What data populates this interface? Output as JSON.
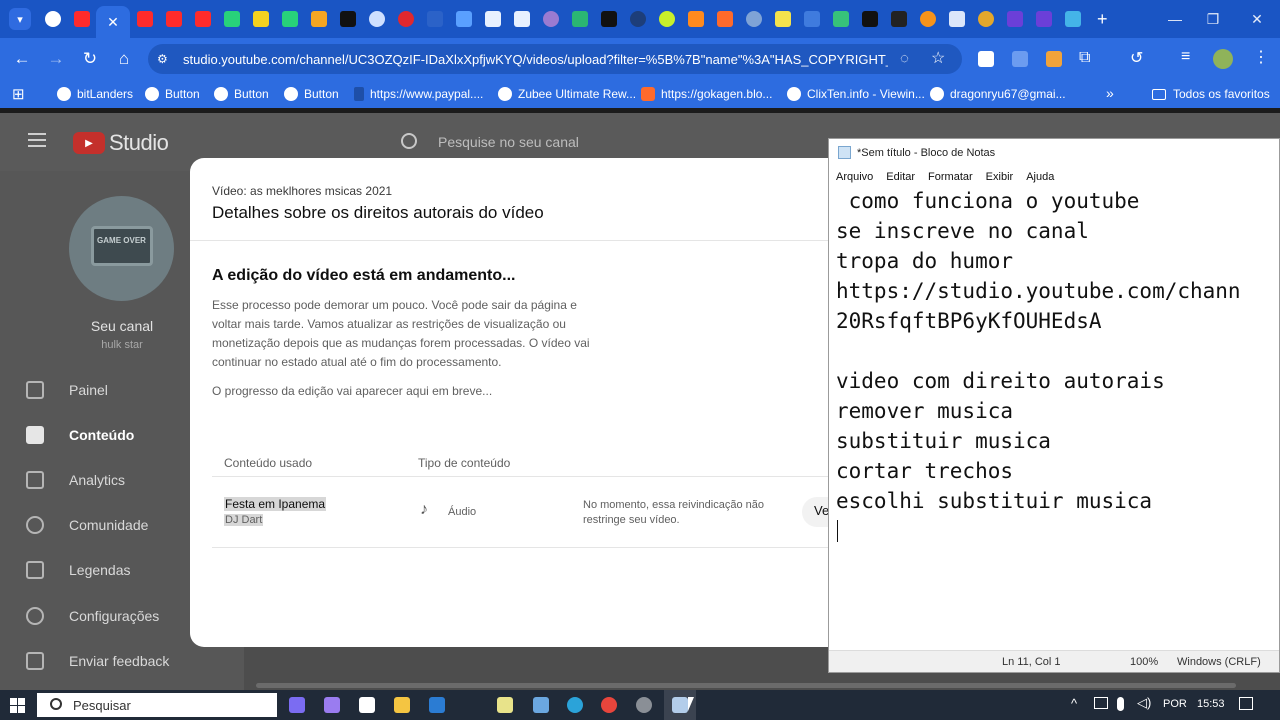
{
  "browser": {
    "url": "studio.youtube.com/channel/UC3OZQzIF-IDaXlxXpfjwKYQ/videos/upload?filter=%5B%7B\"name\"%3A\"HAS_COPYRIGHT_...",
    "bookmarks": [
      "bitLanders",
      "Button",
      "Button",
      "Button",
      "https://www.paypal....",
      "Zubee Ultimate Rew...",
      "https://gokagen.blo...",
      "ClixTen.info - Viewin...",
      "dragonryu67@gmai..."
    ],
    "other_bookmarks": "Todos os favoritos",
    "tab_close": "✕",
    "colors": {
      "frame": "#1a55c4",
      "toolbar": "#2d6ce0"
    }
  },
  "studio": {
    "logo_text": "Studio",
    "search_placeholder": "Pesquise no seu canal",
    "channel_label": "Seu canal",
    "channel_name": "hulk star",
    "avatar_text": "GAME OVER",
    "nav": [
      "Painel",
      "Conteúdo",
      "Analytics",
      "Comunidade",
      "Legendas",
      "Configurações",
      "Enviar feedback"
    ]
  },
  "modal": {
    "video_line": "Vídeo: as meklhores msicas 2021",
    "title": "Detalhes sobre os direitos autorais do vídeo",
    "heading": "A edição do vídeo está em andamento...",
    "description": "Esse processo pode demorar um pouco. Você pode sair da página e voltar mais tarde. Vamos atualizar as restrições de visualização ou monetização depois que as mudanças forem processadas. O vídeo vai continuar no estado atual até o fim do processamento.",
    "progress_note": "O progresso da edição vai aparecer aqui em breve...",
    "col_content": "Conteúdo usado",
    "col_type": "Tipo de conteúdo",
    "row": {
      "song": "Festa em Ipanema",
      "artist": "DJ Dart",
      "type": "Áudio",
      "claim": "No momento, essa reivindicação não restringe seu vídeo.",
      "action": "Ve"
    }
  },
  "notepad": {
    "title": "*Sem título - Bloco de Notas",
    "menu": [
      "Arquivo",
      "Editar",
      "Formatar",
      "Exibir",
      "Ajuda"
    ],
    "lines": [
      " como funciona o youtube",
      "se inscreve no canal",
      "tropa do humor",
      "https://studio.youtube.com/chann",
      "20RsfqftBP6yKfOUHEdsA",
      "",
      "video com direito autorais",
      "remover musica",
      "substituir musica",
      "cortar trechos",
      "escolhi substituir musica",
      ""
    ],
    "status_position": "Ln 11, Col 1",
    "status_zoom": "100%",
    "status_encoding": "Windows (CRLF)"
  },
  "taskbar": {
    "search_placeholder": "Pesquisar",
    "language": "POR",
    "time": "15:53"
  }
}
